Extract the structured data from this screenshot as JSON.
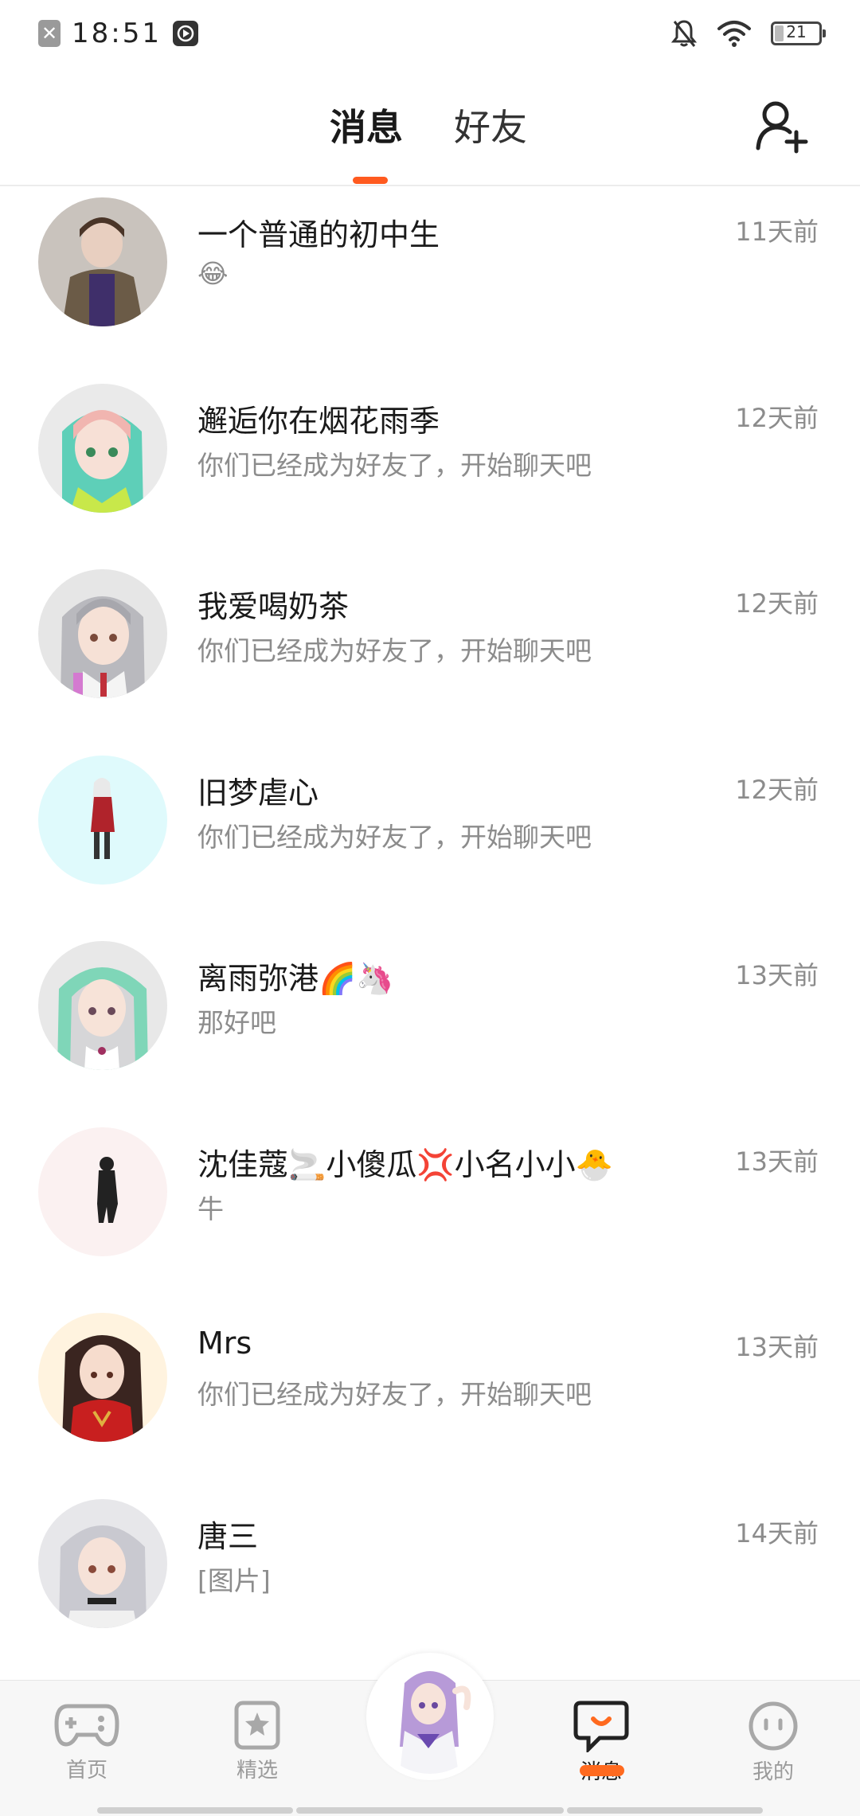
{
  "status_bar": {
    "time": "18:51",
    "battery": "21",
    "battery_level": 0.21
  },
  "header": {
    "tabs": [
      {
        "label": "消息",
        "active": true
      },
      {
        "label": "好友",
        "active": false
      }
    ]
  },
  "conversations": [
    {
      "name": "一个普通的初中生",
      "preview": "😂",
      "time": "11天前"
    },
    {
      "name": "邂逅你在烟花雨季",
      "preview": "你们已经成为好友了，开始聊天吧",
      "time": "12天前"
    },
    {
      "name": "我爱喝奶茶",
      "preview": "你们已经成为好友了，开始聊天吧",
      "time": "12天前"
    },
    {
      "name": "旧梦虐心",
      "preview": "你们已经成为好友了，开始聊天吧",
      "time": "12天前"
    },
    {
      "name": "离雨弥港🌈🦄",
      "preview": "那好吧",
      "time": "13天前"
    },
    {
      "name": "沈佳蔻🚬小傻瓜💢小名小小🐣",
      "preview": "牛",
      "time": "13天前"
    },
    {
      "name": "Mrs",
      "preview": "你们已经成为好友了，开始聊天吧",
      "time": "13天前"
    },
    {
      "name": "唐三",
      "preview": "[图片]",
      "time": "14天前"
    }
  ],
  "bottom_nav": [
    {
      "label": "首页",
      "icon": "gamepad-icon",
      "active": false
    },
    {
      "label": "精选",
      "icon": "star-bookmark-icon",
      "active": false
    },
    {
      "label": "消息",
      "icon": "chat-bubble-icon",
      "active": true
    },
    {
      "label": "我的",
      "icon": "smiley-face-icon",
      "active": false
    }
  ],
  "colors": {
    "accent": "#ff5a1f",
    "text": "#1a1a1a",
    "muted": "#8c8c8c"
  }
}
